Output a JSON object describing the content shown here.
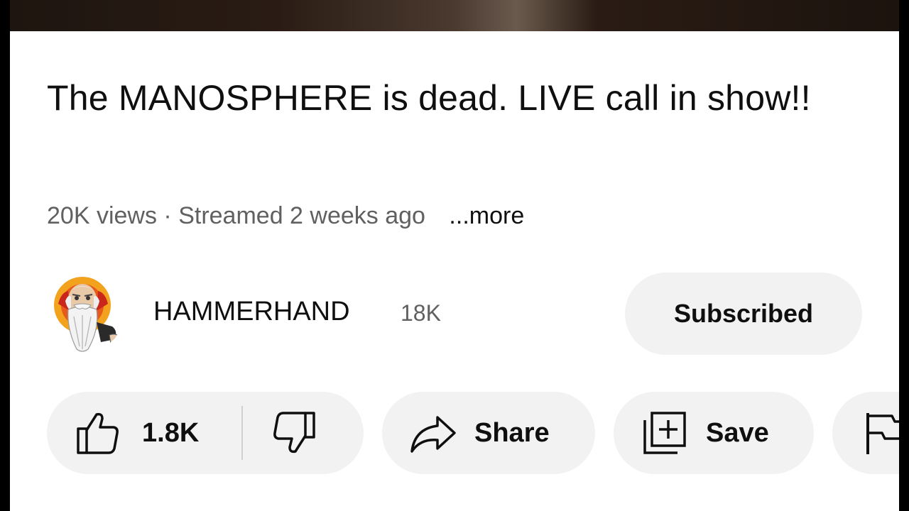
{
  "video": {
    "title": "The MANOSPHERE is dead. LIVE call in show!!",
    "views": "20K views",
    "separator": "·",
    "streamed": "Streamed 2 weeks ago",
    "more_label": "...more"
  },
  "channel": {
    "name": "HAMMERHAND",
    "subscriber_count": "18K",
    "subscribe_label": "Subscribed",
    "avatar_icon": "bearded-old-man-avatar"
  },
  "actions": {
    "like_count": "1.8K",
    "like_icon": "thumbs-up-icon",
    "dislike_icon": "thumbs-down-icon",
    "share_label": "Share",
    "share_icon": "share-arrow-icon",
    "save_label": "Save",
    "save_icon": "playlist-add-icon",
    "report_icon": "flag-icon"
  },
  "colors": {
    "background": "#ffffff",
    "text_primary": "#0f0f0f",
    "text_secondary": "#606060",
    "chip_background": "#f2f2f2"
  }
}
